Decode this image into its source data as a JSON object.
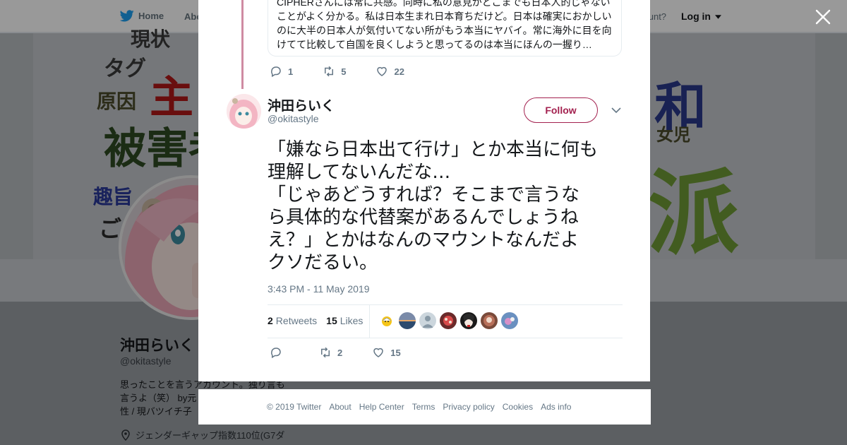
{
  "nav": {
    "home_label": "Home",
    "about_label": "Abo",
    "have_account_label": "count?",
    "login_label": "Log in"
  },
  "banner": {
    "words": [
      "現状",
      "タグ",
      "原因",
      "主",
      "被害者",
      "趣旨",
      "ご",
      "和",
      "女児",
      "派"
    ]
  },
  "profile": {
    "name": "沖田らいく",
    "handle": "@okitastyle",
    "bio_lines": [
      "思ったことを言うアカウント。独り言も",
      "言うよ（笑） by元",
      "性 / 現バツイチ子"
    ],
    "location": "ジェンダーギャップ指数110位(G7ダ"
  },
  "previous_tweet": {
    "text_lines": [
      "CIPHERさんには常に共感。同時に私の意見がどこまでも日本人的じゃない",
      "ことがよく分かる。私は日本生まれ日本育ちだけど。日本は確実におかしい",
      "のに大半の日本人が気付いてない所がもう本当にヤバイ。常に海外に目を向",
      "けてて比較して自国を良くしようと思ってるのは本当にほんの一握り…"
    ],
    "replies": "1",
    "retweets": "5",
    "likes": "22"
  },
  "tweet": {
    "author_name": "沖田らいく",
    "author_handle": "@okitastyle",
    "follow_label": "Follow",
    "text_lines": [
      "「嫌なら日本出て行け」とか本当に何も",
      "理解してないんだな…",
      "「じゃあどうすれば？そこまで言うな",
      "ら具体的な代替案があるんでしょうね",
      "え？」とかはなんのマウントなんだよ",
      "クソだるい。"
    ],
    "timestamp": "3:43 PM - 11 May 2019",
    "retweet_count": "2",
    "retweets_label": "Retweets",
    "like_count": "15",
    "likes_label": "Likes",
    "action_retweets": "2",
    "action_likes": "15"
  },
  "footer": {
    "links": [
      "© 2019 Twitter",
      "About",
      "Help Center",
      "Terms",
      "Privacy policy",
      "Cookies",
      "Ads info"
    ]
  },
  "colors": {
    "twitter_blue": "#1da1f2",
    "follow_accent": "#a3214f",
    "thread_line": "#cf8ba2",
    "muted_text": "#657786"
  }
}
